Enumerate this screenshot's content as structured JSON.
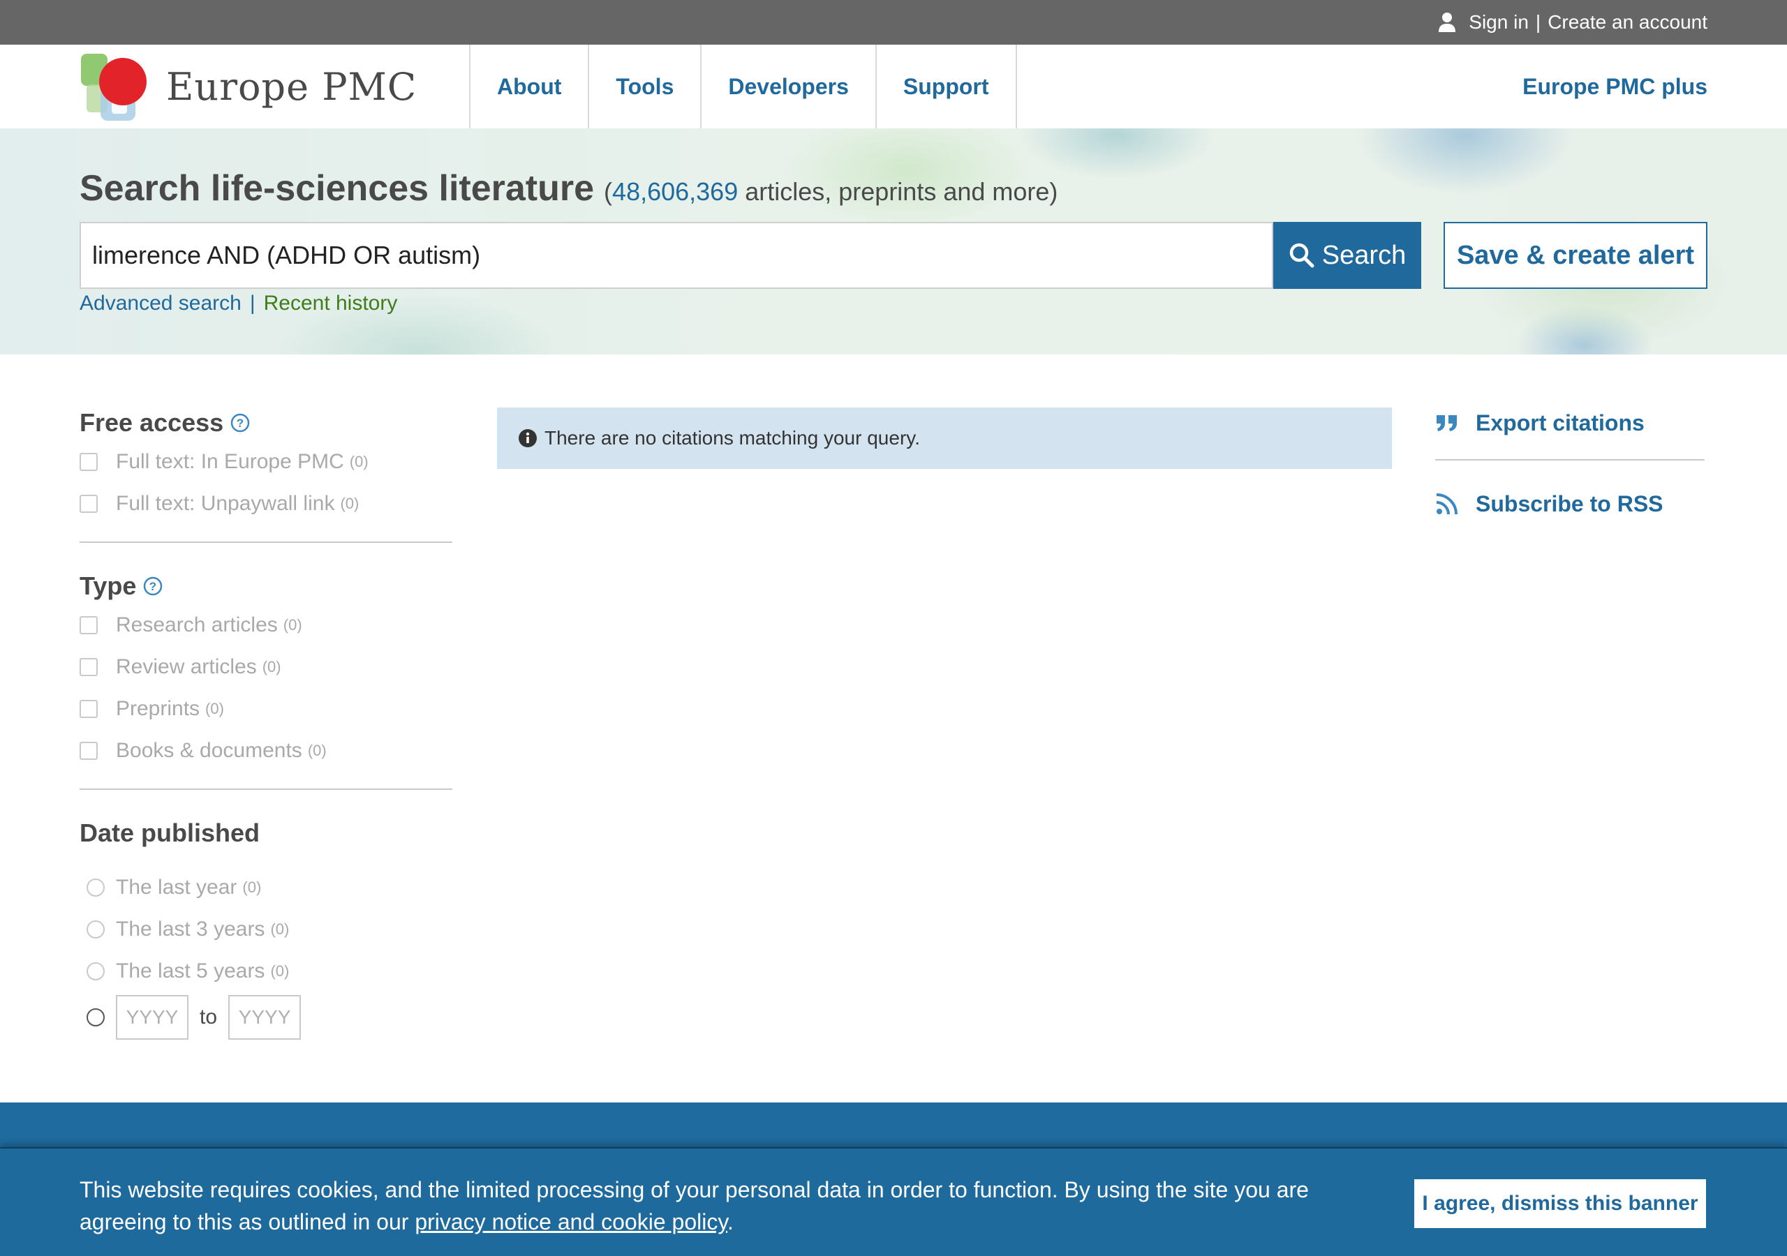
{
  "topbar": {
    "sign_in": "Sign in",
    "separator": "|",
    "create_account": "Create an account"
  },
  "header": {
    "logo_text": "Europe PMC",
    "nav": [
      "About",
      "Tools",
      "Developers",
      "Support"
    ],
    "plus": "Europe PMC plus"
  },
  "search": {
    "title": "Search life-sciences literature",
    "count_open": "(",
    "count": "48,606,369",
    "count_suffix": " articles, preprints and more)",
    "query": "limerence AND (ADHD OR autism)",
    "search_button": "Search",
    "alert_button": "Save & create alert",
    "advanced": "Advanced search",
    "links_separator": "|",
    "recent": "Recent history"
  },
  "filters": {
    "free_access": {
      "heading": "Free access",
      "options": [
        {
          "label": "Full text: In Europe PMC",
          "count": "(0)"
        },
        {
          "label": "Full text: Unpaywall link",
          "count": "(0)"
        }
      ]
    },
    "type": {
      "heading": "Type",
      "options": [
        {
          "label": "Research articles",
          "count": "(0)"
        },
        {
          "label": "Review articles",
          "count": "(0)"
        },
        {
          "label": "Preprints",
          "count": "(0)"
        },
        {
          "label": "Books & documents",
          "count": "(0)"
        }
      ]
    },
    "date": {
      "heading": "Date published",
      "options": [
        {
          "label": "The last year",
          "count": "(0)"
        },
        {
          "label": "The last 3 years",
          "count": "(0)"
        },
        {
          "label": "The last 5 years",
          "count": "(0)"
        }
      ],
      "from_placeholder": "YYYY",
      "to_label": "to",
      "to_placeholder": "YYYY"
    }
  },
  "results": {
    "message": "There are no citations matching your query."
  },
  "actions": {
    "export": "Export citations",
    "rss": "Subscribe to RSS"
  },
  "cookie": {
    "text_before": "This website requires cookies, and the limited processing of your personal data in order to function. By using the site you are agreeing to this as outlined in our ",
    "policy_link": "privacy notice and cookie policy",
    "text_after": ".",
    "agree_button": "I agree, dismiss this banner"
  },
  "colors": {
    "brand_blue": "#20699c",
    "topbar_gray": "#666666",
    "recent_green": "#3f7d1a",
    "info_bg": "#d3e4f0"
  }
}
